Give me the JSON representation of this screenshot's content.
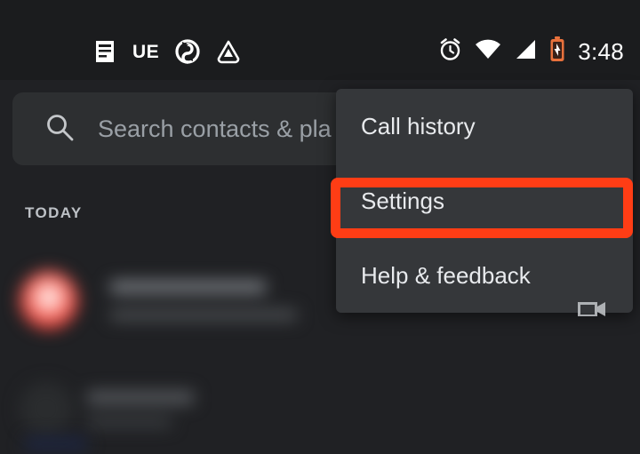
{
  "status_bar": {
    "notification_icons": [
      {
        "name": "list-document-icon",
        "glyph": "document"
      },
      {
        "name": "ue-app-icon",
        "label": "UE"
      },
      {
        "name": "sync-icon",
        "glyph": "sync"
      },
      {
        "name": "drive-triangle-icon",
        "glyph": "triangle"
      }
    ],
    "system_icons": [
      {
        "name": "alarm-icon"
      },
      {
        "name": "wifi-icon"
      },
      {
        "name": "cell-signal-icon"
      },
      {
        "name": "battery-charging-icon"
      }
    ],
    "time": "3:48",
    "battery_color": "#e8713c"
  },
  "search": {
    "placeholder": "Search contacts & pla",
    "value": "",
    "icon": "search-icon"
  },
  "list": {
    "section_header": "TODAY"
  },
  "overflow_menu": {
    "items": [
      {
        "label": "Call history",
        "name": "menu-item-call-history"
      },
      {
        "label": "Settings",
        "name": "menu-item-settings"
      },
      {
        "label": "Help & feedback",
        "name": "menu-item-help-feedback"
      }
    ],
    "background": "#35373a",
    "highlighted_item": "Settings"
  },
  "highlight": {
    "color": "#ff3d15",
    "target": "Settings"
  },
  "theme": {
    "background": "#202124",
    "status_bar_background": "#1b1c1e",
    "search_background": "#2d2f31",
    "text_primary": "#e8eaed",
    "text_secondary": "#9aa0a6"
  }
}
